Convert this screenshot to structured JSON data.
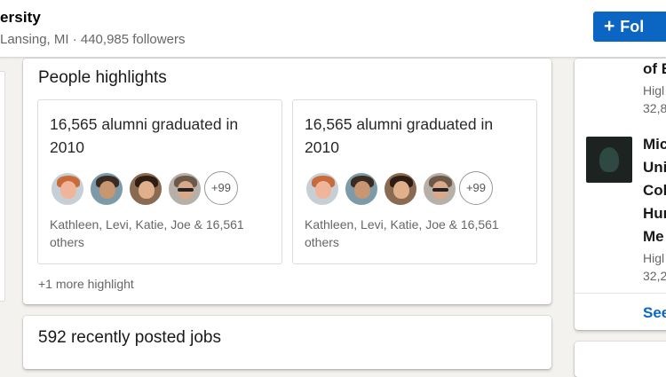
{
  "header": {
    "org_name": "ersity",
    "org_meta": "Lansing, MI · 440,985 followers",
    "follow_label": "Fol"
  },
  "highlights": {
    "title": "People highlights",
    "cards": [
      {
        "headline": "16,565 alumni graduated in 2010",
        "more_count": "+99",
        "names": "Kathleen, Levi, Katie, Joe & 16,561 others"
      },
      {
        "headline": "16,565 alumni graduated in 2010",
        "more_count": "+99",
        "names": "Kathleen, Levi, Katie, Joe & 16,561 others"
      }
    ],
    "more_link": "+1 more highlight"
  },
  "jobs": {
    "title": "592 recently posted jobs"
  },
  "sidebar": {
    "item1_line": "of E",
    "item1_sub1": "Higl",
    "item1_sub2": "32,8",
    "item2_lines": [
      "Mic",
      "Uni",
      "Col",
      "Hur",
      "Me"
    ],
    "item2_sub1": "Higl",
    "item2_sub2": "32,2",
    "see_all": "See"
  },
  "colors": {
    "brand_blue": "#0a66c2",
    "page_bg": "#f3f2ef",
    "avatar_bgs": [
      "#c7cfd6",
      "#7c9aa8",
      "#8a6b52",
      "#b7b0a8"
    ]
  },
  "icons": {
    "follow": "plus-icon",
    "logo": "spartan-logo-icon"
  }
}
